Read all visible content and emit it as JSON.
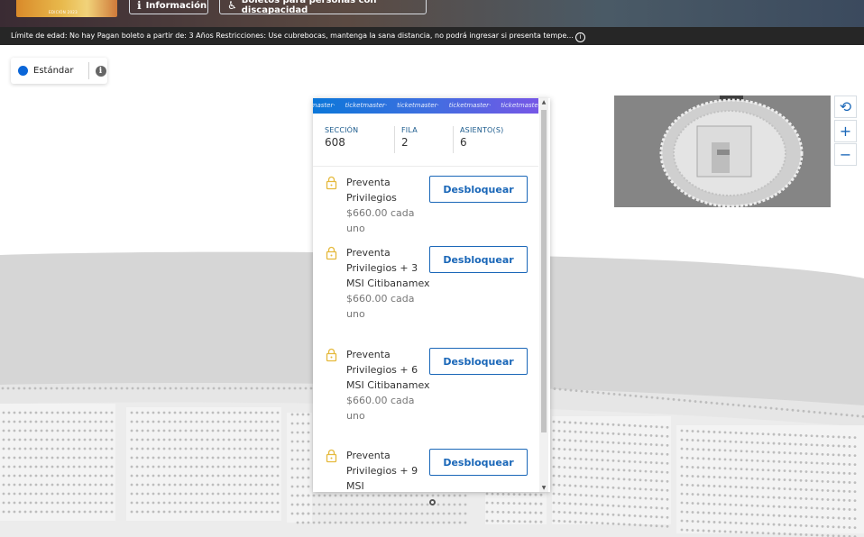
{
  "header": {
    "event_thumb_text": "EDICIÓN 2023",
    "info_button": "Información",
    "info_icon": "info-i-icon",
    "accessibility_button": "Boletos para personas con discapacidad",
    "accessibility_icon": "wheelchair-icon"
  },
  "restrictions": {
    "text": "Límite de edad: No hay Pagan boleto a partir de: 3 Años Restricciones: Use cubrebocas, mantenga la sana distancia, no podrá ingresar si presenta tempe...",
    "more_icon": "info-circle-icon",
    "more_glyph": "i"
  },
  "legend": {
    "label": "Estándar",
    "dot_color": "#0a66d8",
    "info_glyph": "i"
  },
  "popup": {
    "brand": "ticketmaster",
    "section_label": "SECCIÓN",
    "section_value": "608",
    "row_label": "FILA",
    "row_value": "2",
    "seat_label": "ASIENTO(S)",
    "seat_value": "6",
    "offers": [
      {
        "name": "Preventa Privilegios",
        "price": "$660.00 cada uno",
        "button": "Desbloquear"
      },
      {
        "name": "Preventa Privilegios + 3 MSI Citibanamex",
        "price": "$660.00 cada uno",
        "button": "Desbloquear"
      },
      {
        "name": "Preventa Privilegios + 6 MSI Citibanamex",
        "price": "$660.00 cada uno",
        "button": "Desbloquear"
      },
      {
        "name": "Preventa Privilegios + 9 MSI",
        "price": "",
        "button": "Desbloquear"
      }
    ]
  },
  "map_controls": {
    "reset_icon": "refresh-icon",
    "zoom_in": "+",
    "zoom_out": "−"
  },
  "colors": {
    "accent": "#1a67b8",
    "lock": "#e5b93b",
    "map_gray": "#d6d6d6",
    "minimap_bg": "#858585"
  }
}
